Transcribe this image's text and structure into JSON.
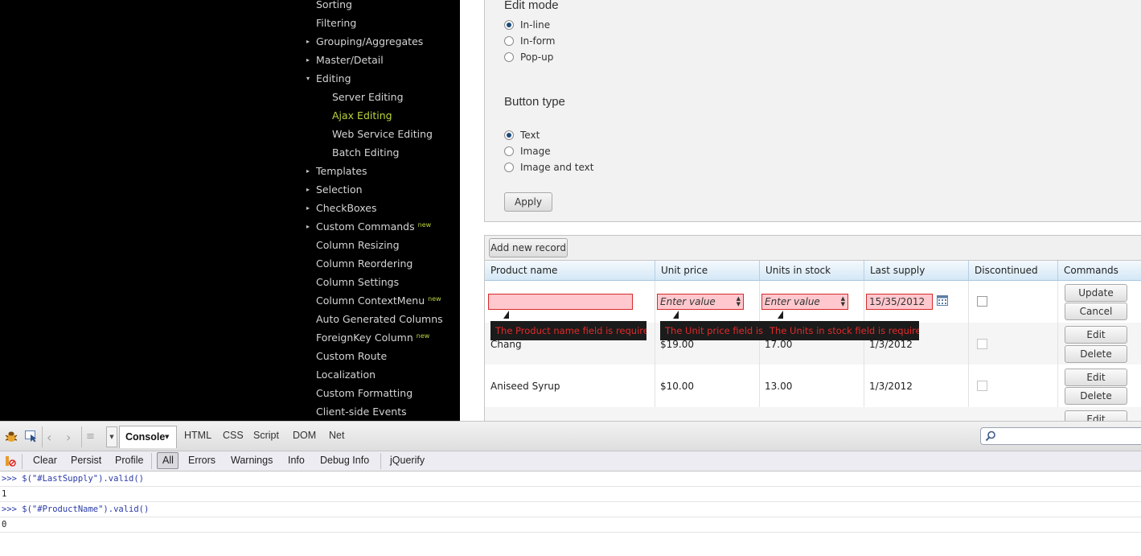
{
  "sidebar": {
    "items": [
      {
        "label": "Sorting",
        "arrow": "",
        "sub": false,
        "active": false,
        "badge": ""
      },
      {
        "label": "Filtering",
        "arrow": "",
        "sub": false,
        "active": false,
        "badge": ""
      },
      {
        "label": "Grouping/Aggregates",
        "arrow": "▸",
        "sub": false,
        "active": false,
        "badge": ""
      },
      {
        "label": "Master/Detail",
        "arrow": "▸",
        "sub": false,
        "active": false,
        "badge": ""
      },
      {
        "label": "Editing",
        "arrow": "▾",
        "sub": false,
        "active": false,
        "badge": ""
      },
      {
        "label": "Server Editing",
        "arrow": "",
        "sub": true,
        "active": false,
        "badge": ""
      },
      {
        "label": "Ajax Editing",
        "arrow": "",
        "sub": true,
        "active": true,
        "badge": ""
      },
      {
        "label": "Web Service Editing",
        "arrow": "",
        "sub": true,
        "active": false,
        "badge": ""
      },
      {
        "label": "Batch Editing",
        "arrow": "",
        "sub": true,
        "active": false,
        "badge": ""
      },
      {
        "label": "Templates",
        "arrow": "▸",
        "sub": false,
        "active": false,
        "badge": ""
      },
      {
        "label": "Selection",
        "arrow": "▸",
        "sub": false,
        "active": false,
        "badge": ""
      },
      {
        "label": "CheckBoxes",
        "arrow": "▸",
        "sub": false,
        "active": false,
        "badge": ""
      },
      {
        "label": "Custom Commands",
        "arrow": "▸",
        "sub": false,
        "active": false,
        "badge": "new"
      },
      {
        "label": "Column Resizing",
        "arrow": "",
        "sub": false,
        "active": false,
        "badge": ""
      },
      {
        "label": "Column Reordering",
        "arrow": "",
        "sub": false,
        "active": false,
        "badge": ""
      },
      {
        "label": "Column Settings",
        "arrow": "",
        "sub": false,
        "active": false,
        "badge": ""
      },
      {
        "label": "Column ContextMenu",
        "arrow": "",
        "sub": false,
        "active": false,
        "badge": "new"
      },
      {
        "label": "Auto Generated Columns",
        "arrow": "",
        "sub": false,
        "active": false,
        "badge": ""
      },
      {
        "label": "ForeignKey Column",
        "arrow": "",
        "sub": false,
        "active": false,
        "badge": "new"
      },
      {
        "label": "Custom Route",
        "arrow": "",
        "sub": false,
        "active": false,
        "badge": ""
      },
      {
        "label": "Localization",
        "arrow": "",
        "sub": false,
        "active": false,
        "badge": ""
      },
      {
        "label": "Custom Formatting",
        "arrow": "",
        "sub": false,
        "active": false,
        "badge": ""
      },
      {
        "label": "Client-side Events",
        "arrow": "",
        "sub": false,
        "active": false,
        "badge": ""
      }
    ]
  },
  "options": {
    "edit_mode_title": "Edit mode",
    "edit_mode_options": [
      "In-line",
      "In-form",
      "Pop-up"
    ],
    "edit_mode_selected": 0,
    "button_type_title": "Button type",
    "button_type_options": [
      "Text",
      "Image",
      "Image and text"
    ],
    "button_type_selected": 0,
    "apply_label": "Apply"
  },
  "grid": {
    "add_new_label": "Add new record",
    "columns": [
      "Product name",
      "Unit price",
      "Units in stock",
      "Last supply",
      "Discontinued",
      "Commands"
    ],
    "edit_row": {
      "product_name": "",
      "unit_price_placeholder": "Enter value",
      "units_in_stock_placeholder": "Enter value",
      "last_supply": "15/35/2012",
      "update_label": "Update",
      "cancel_label": "Cancel"
    },
    "errors": {
      "product_name": "The Product name field is required.",
      "unit_price": "The Unit price field is re",
      "units_in_stock": "The Units in stock field is required."
    },
    "rows": [
      {
        "product_name": "Chang",
        "unit_price": "$19.00",
        "units_in_stock": "17.00",
        "last_supply": "1/3/2012"
      },
      {
        "product_name": "Aniseed Syrup",
        "unit_price": "$10.00",
        "units_in_stock": "13.00",
        "last_supply": "1/3/2012"
      }
    ],
    "edit_label": "Edit",
    "delete_label": "Delete"
  },
  "firebug": {
    "console_tab": "Console",
    "tabs": [
      "HTML",
      "CSS",
      "Script",
      "DOM",
      "Net"
    ],
    "toolbar2": [
      "Clear",
      "Persist",
      "Profile",
      "All",
      "Errors",
      "Warnings",
      "Info",
      "Debug Info",
      "jQuerify"
    ],
    "console_lines": [
      {
        "text": ">>> $(\"#LastSupply\").valid()",
        "kind": "cmd"
      },
      {
        "text": "1",
        "kind": "result"
      },
      {
        "text": ">>> $(\"#ProductName\").valid()",
        "kind": "cmd"
      },
      {
        "text": "0",
        "kind": "result"
      }
    ]
  },
  "colors": {
    "accent": "#b9d53c",
    "error": "#e32a2a",
    "error_bg": "#ffc8ce"
  }
}
